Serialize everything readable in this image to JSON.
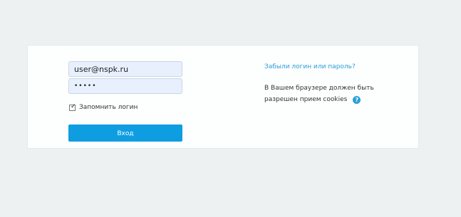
{
  "login": {
    "username_value": "user@nspk.ru",
    "password_value": "•••••",
    "remember_checked": true,
    "remember_label": "Запомнить логин",
    "submit_label": "Вход"
  },
  "info": {
    "forgot_link": "Забыли логин или пароль?",
    "cookies_line1": "В Вашем браузере должен быть",
    "cookies_line2": "разрешен прием cookies",
    "help_icon": "?"
  },
  "colors": {
    "accent": "#0f9de1",
    "link": "#2a9fd8",
    "background": "#eef1f1",
    "input_fill": "#e8f0fe"
  },
  "icons": {
    "help": "question-circle-icon",
    "checkbox": "checkmark-icon"
  }
}
